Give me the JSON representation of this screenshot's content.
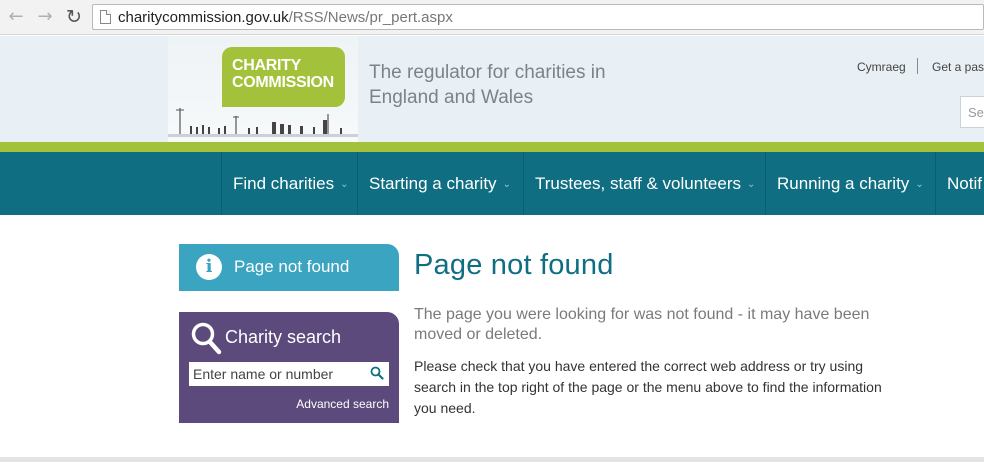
{
  "browser": {
    "url_domain": "charitycommission.gov.uk",
    "url_path": "/RSS/News/pr_pert.aspx"
  },
  "header": {
    "logo_line1": "CHARITY",
    "logo_line2": "COMMISSION",
    "tagline": "The regulator for charities in England and Wales",
    "util_links": [
      "Cymraeg",
      "Get a pas"
    ],
    "search_placeholder": "Se"
  },
  "nav": {
    "items": [
      {
        "label": "Find charities"
      },
      {
        "label": "Starting a charity"
      },
      {
        "label": "Trustees, staff & volunteers"
      },
      {
        "label": "Running a charity"
      },
      {
        "label": "Notif"
      }
    ]
  },
  "sidebar": {
    "page_not_found_label": "Page not found",
    "charity_search_title": "Charity search",
    "search_placeholder": "Enter name or number",
    "advanced_search": "Advanced search"
  },
  "main": {
    "title": "Page not found",
    "lead": "The page you were looking for was not found - it may have been moved or deleted.",
    "body": "Please check that you have entered the correct web address or try using search in the top right of the page or the menu above to find the information you need."
  },
  "colors": {
    "nav_bg": "#0f6e82",
    "accent_green": "#a3c13a",
    "info_blue": "#3aa4c1",
    "search_purple": "#5b4a7b"
  }
}
